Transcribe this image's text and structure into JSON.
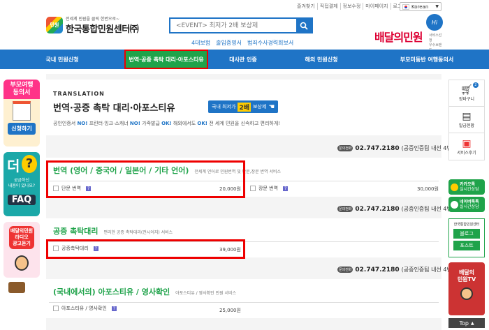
{
  "top_links": [
    "즐겨찾기",
    "직접결제",
    "정보수정",
    "마이페이지",
    "로그아웃"
  ],
  "language": "Korean",
  "logo": {
    "mark": "민원",
    "sub": "전세계 민원을 클릭 한번으로~",
    "main": "한국통합민원센터㈜"
  },
  "search": {
    "placeholder": "<EVENT> 최저가 2배 보상제"
  },
  "quick_links": [
    "4대보험",
    "출입증명서",
    "범죄수사경력회보서"
  ],
  "brand": {
    "name": "배달의민원",
    "badge": "Hi",
    "tag1": "서비스선정",
    "tag2": "우수브랜드"
  },
  "nav": [
    "국내 민원신청",
    "번역·공증 촉탁 대리·아포스티유",
    "대사관 인증",
    "해외 민원신청",
    "부모미동반 여행동의서"
  ],
  "left_banners": {
    "b1": {
      "line1": "부모여행",
      "line2": "동의서",
      "cta": "신청하기"
    },
    "b2": {
      "big": "더",
      "q1": "궁금하신",
      "q2": "내용이 있나요?",
      "faq": "FAQ"
    },
    "b3": {
      "l1": "배달의민원",
      "l2": "라디오",
      "l3": "광고듣기"
    }
  },
  "header_card": {
    "en": "TRANSLATION",
    "title": "번역·공증 촉탁 대리·아포스티유",
    "badge_pre": "국내 최저가",
    "badge_num": "2배",
    "badge_post": "보상제",
    "desc": [
      {
        "t": "공인인증서 ",
        "b": "NO!"
      },
      {
        "t": " 프린터·잉크·스캐너 ",
        "b": "NO!"
      },
      {
        "t": " 가족발급 ",
        "b": "OK!"
      },
      {
        "t": " 해외에서도 ",
        "b": "OK!"
      },
      {
        "t": " 전 세계 민원을 신속하고 편리하게!",
        "b": ""
      }
    ]
  },
  "phone": {
    "badge": "문의전화",
    "number": "02.747.2180",
    "note": "(공증인증팀 내선 4번)"
  },
  "sections": [
    {
      "title": "번역 (영어 / 중국어 / 일본어 / 기타 언어)",
      "sub": "전세계 언어로 민원번역 및 단문,장문 번역 서비스",
      "items": [
        {
          "label": "단문 번역",
          "price": "20,000원"
        },
        {
          "label": "장문 번역",
          "price": "30,000원"
        }
      ]
    },
    {
      "title": "공증 촉탁대리",
      "sub": "편리한 공증 촉탁대리(전시어지) 서비스",
      "items": [
        {
          "label": "공증촉탁대리",
          "price": "39,000원"
        }
      ]
    },
    {
      "title": "(국내에서의) 아포스티유 / 영사확인",
      "sub": "아포스티유 / 영사확인 민원 서비스",
      "items": [
        {
          "label": "아포스티유 / 영사확인",
          "price": "25,000원"
        }
      ]
    }
  ],
  "right_panel": {
    "cart": "장바구니",
    "cart_count": "2",
    "history": "발급현황",
    "review": "서비스후기",
    "kakao1": "카카오톡",
    "kakao2": "실시간상담",
    "naver1": "네이버톡톡",
    "naver2": "실시간상담",
    "official": "한국통합민원센터",
    "blog": "블로그",
    "post": "포스트",
    "tv1": "배달의",
    "tv2": "민원TV",
    "top": "Top"
  },
  "colors": {
    "primary": "#1f74c6",
    "green": "#1fa34a",
    "highlight": "#e00000"
  }
}
